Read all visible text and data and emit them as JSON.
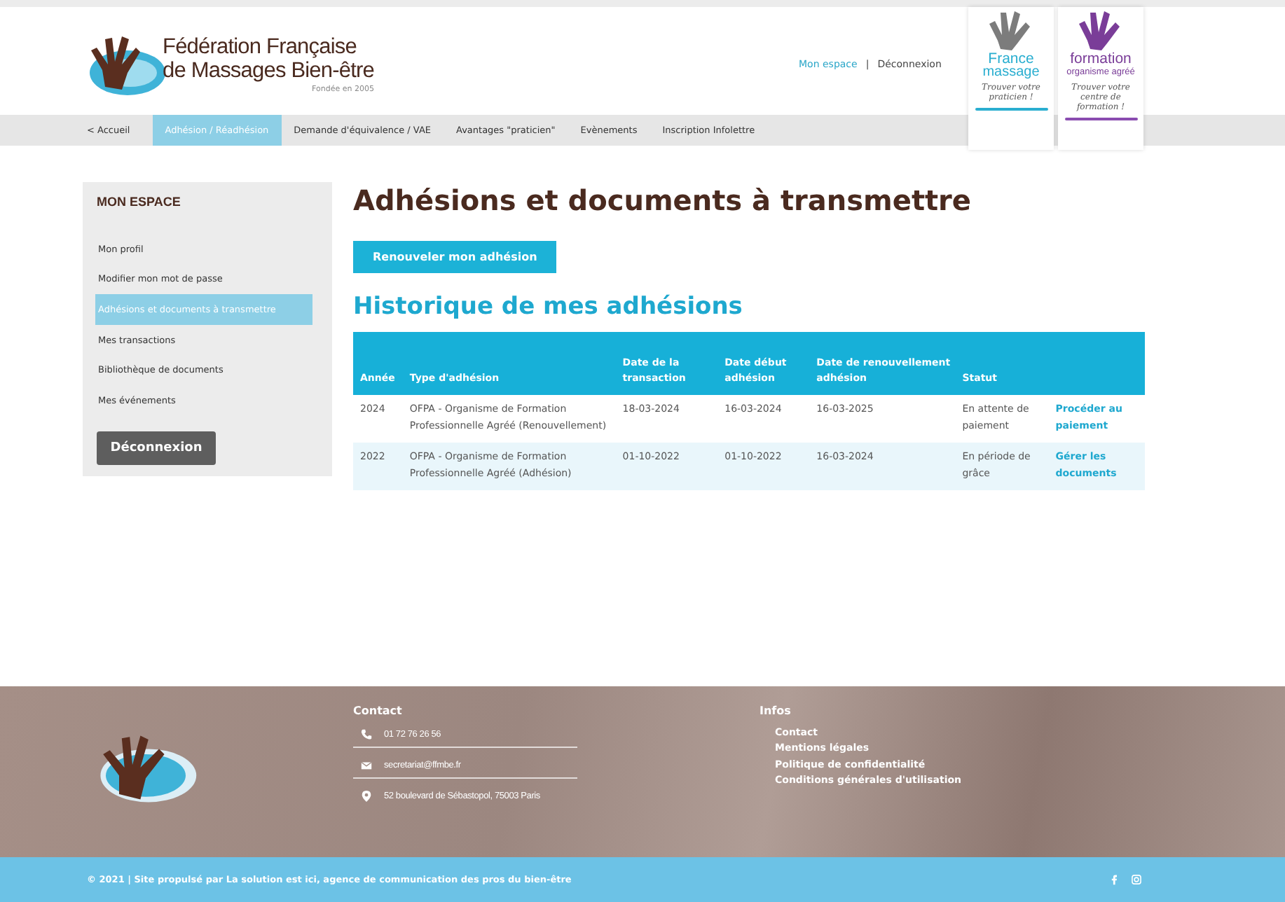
{
  "header": {
    "org_line1": "Fédération Française",
    "org_line2": "de Massages Bien-être",
    "founded": "Fondée en 2005",
    "user_links": [
      {
        "label": "Mon espace"
      },
      {
        "label": "Déconnexion"
      }
    ],
    "link_separator": "|",
    "badges": [
      {
        "kind": "grey",
        "title": "France",
        "subtitle": "massage",
        "tagline": "Trouver votre praticien !"
      },
      {
        "kind": "purple",
        "title": "formation",
        "subtitle": "organisme agréé",
        "tagline": "Trouver votre centre de formation !"
      }
    ]
  },
  "nav": [
    {
      "label": "< Accueil",
      "selected": false
    },
    {
      "label": "Adhésion / Réadhésion",
      "selected": true
    },
    {
      "label": "Demande d'équivalence / VAE",
      "selected": false
    },
    {
      "label": "Avantages \"praticien\"",
      "selected": false
    },
    {
      "label": "Evènements",
      "selected": false
    },
    {
      "label": "Inscription Infolettre",
      "selected": false
    }
  ],
  "sidebar": {
    "title": "MON ESPACE",
    "items": [
      {
        "label": "Mon profil",
        "selected": false
      },
      {
        "label": "Modifier mon mot de passe",
        "selected": false
      },
      {
        "label": "Adhésions et documents à transmettre",
        "selected": true
      },
      {
        "label": "Mes transactions",
        "selected": false
      },
      {
        "label": "Bibliothèque de documents",
        "selected": false
      },
      {
        "label": "Mes événements",
        "selected": false
      }
    ],
    "logout": "Déconnexion"
  },
  "main": {
    "title": "Adhésions et documents à transmettre",
    "renew_button": "Renouveler mon adhésion",
    "history_title": "Historique de mes adhésions",
    "table": {
      "columns": [
        "Année",
        "Type d'adhésion",
        "Date de la transaction",
        "Date début adhésion",
        "Date de renouvellement adhésion",
        "Statut"
      ],
      "rows": [
        {
          "cells": [
            "2024",
            "OFPA - Organisme de Formation Professionnelle Agréé (Renouvellement)",
            "18-03-2024",
            "16-03-2024",
            "16-03-2025",
            "En attente de paiement"
          ],
          "action": "Procéder au paiement"
        },
        {
          "cells": [
            "2022",
            "OFPA - Organisme de Formation Professionnelle Agréé (Adhésion)",
            "01-10-2022",
            "01-10-2022",
            "16-03-2024",
            "En période de grâce"
          ],
          "action": "Gérer les documents"
        }
      ]
    }
  },
  "footer": {
    "contact_title": "Contact",
    "contacts": [
      {
        "kind": "phone",
        "text": "01 72 76 26 56"
      },
      {
        "kind": "mail",
        "text": "secretariat@ffmbe.fr"
      },
      {
        "kind": "pin",
        "text": "52 boulevard de Sébastopol, 75003 Paris"
      }
    ],
    "infos_title": "Infos",
    "infos": [
      "Contact",
      "Mentions légales",
      "Politique de confidentialité",
      "Conditions générales d'utilisation"
    ],
    "copyright": "© 2021 | Site propulsé par La solution est ici, agence de communication des pros du bien-être"
  }
}
